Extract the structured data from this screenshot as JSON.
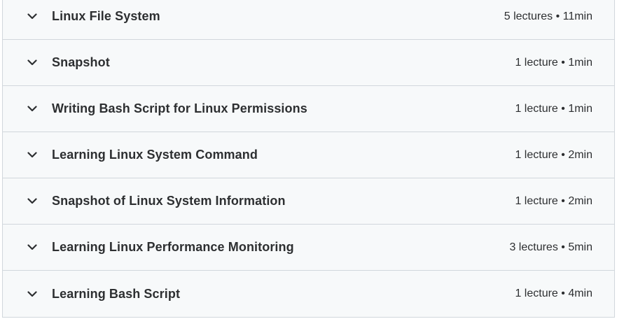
{
  "curriculum": {
    "sections": [
      {
        "title": "Linux File System",
        "meta": "5 lectures • 11min",
        "icon": "chevron-down-icon"
      },
      {
        "title": "Snapshot",
        "meta": "1 lecture • 1min",
        "icon": "chevron-down-icon"
      },
      {
        "title": "Writing Bash Script for Linux Permissions",
        "meta": "1 lecture • 1min",
        "icon": "chevron-down-icon"
      },
      {
        "title": "Learning Linux System Command",
        "meta": "1 lecture • 2min",
        "icon": "chevron-down-icon"
      },
      {
        "title": "Snapshot of Linux System Information",
        "meta": "1 lecture • 2min",
        "icon": "chevron-down-icon"
      },
      {
        "title": "Learning Linux Performance Monitoring",
        "meta": "3 lectures • 5min",
        "icon": "chevron-down-icon"
      },
      {
        "title": "Learning Bash Script",
        "meta": "1 lecture • 4min",
        "icon": "chevron-down-icon"
      }
    ]
  }
}
